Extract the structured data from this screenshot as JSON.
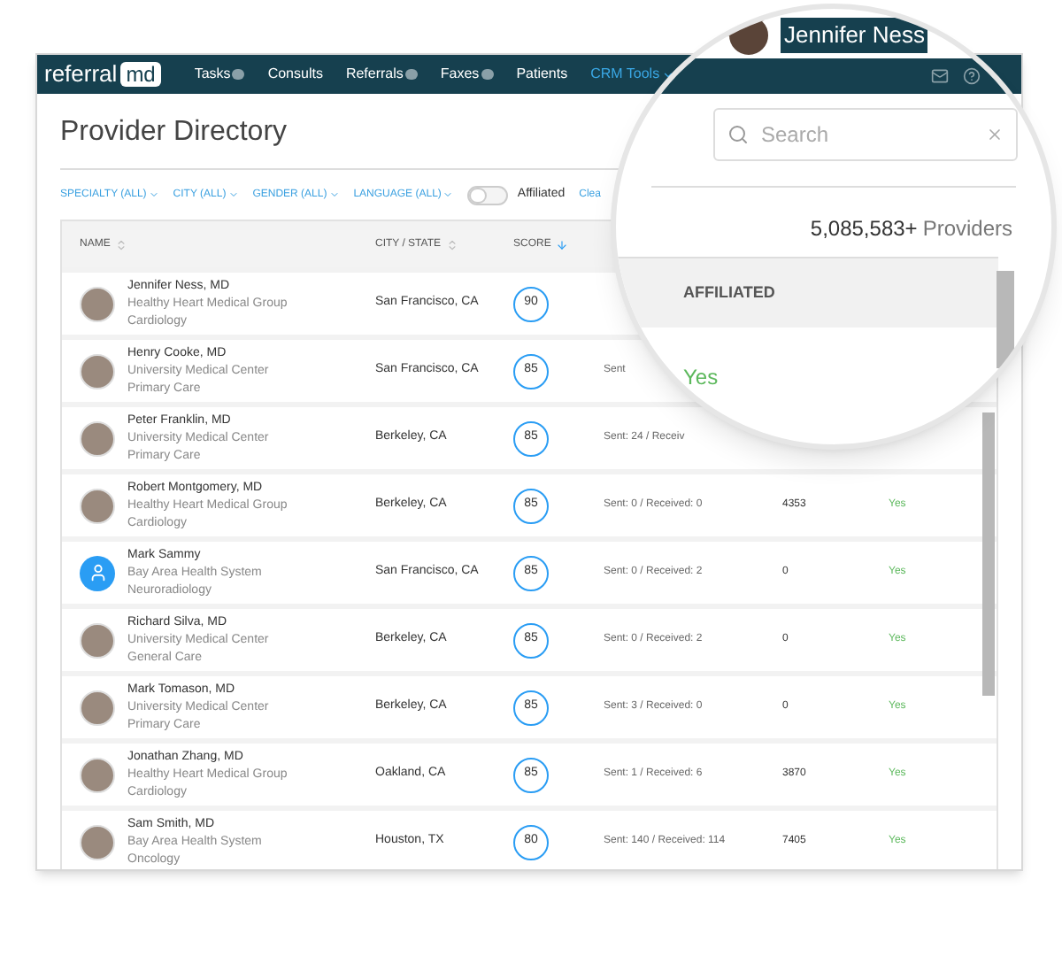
{
  "logo": {
    "text": "referral",
    "badge": "md"
  },
  "nav": [
    {
      "label": "Tasks",
      "has_badge": true,
      "selected": false,
      "dropdown": false
    },
    {
      "label": "Consults",
      "has_badge": false,
      "selected": false,
      "dropdown": false
    },
    {
      "label": "Referrals",
      "has_badge": true,
      "selected": false,
      "dropdown": false
    },
    {
      "label": "Faxes",
      "has_badge": true,
      "selected": false,
      "dropdown": false
    },
    {
      "label": "Patients",
      "has_badge": false,
      "selected": false,
      "dropdown": false
    },
    {
      "label": "CRM Tools",
      "has_badge": false,
      "selected": true,
      "dropdown": true
    }
  ],
  "page_title": "Provider Directory",
  "filters": [
    "SPECIALTY (ALL)",
    "CITY (ALL)",
    "GENDER (ALL)",
    "LANGUAGE (ALL)"
  ],
  "affiliated_toggle": {
    "label": "Affiliated",
    "on": false
  },
  "clear_link": "Clea",
  "table": {
    "columns": [
      {
        "label": "NAME",
        "sorted": false
      },
      {
        "label": "CITY / STATE",
        "sorted": false
      },
      {
        "label": "SCORE",
        "sorted": true
      }
    ],
    "rows": [
      {
        "name": "Jennifer Ness, MD",
        "org": "Healthy Heart Medical Group",
        "specialty": "Cardiology",
        "generic_avatar": false,
        "city": "San Francisco, CA",
        "score": "90"
      },
      {
        "name": "Henry Cooke, MD",
        "org": "University Medical Center",
        "specialty": "Primary Care",
        "generic_avatar": false,
        "city": "San Francisco, CA",
        "score": "85",
        "referrals": "Sent"
      },
      {
        "name": "Peter Franklin, MD",
        "org": "University Medical Center",
        "specialty": "Primary Care",
        "generic_avatar": false,
        "city": "Berkeley, CA",
        "score": "85",
        "referrals": "Sent: 24 / Receiv"
      },
      {
        "name": "Robert Montgomery, MD",
        "org": "Healthy Heart Medical Group",
        "specialty": "Cardiology",
        "generic_avatar": false,
        "city": "Berkeley, CA",
        "score": "85",
        "referrals": "Sent: 0 / Received: 0",
        "column_5": "4353",
        "affiliated": "Yes"
      },
      {
        "name": "Mark Sammy",
        "org": "Bay Area Health System",
        "specialty": "Neuroradiology",
        "generic_avatar": true,
        "city": "San Francisco, CA",
        "score": "85",
        "referrals": "Sent: 0 / Received: 2",
        "column_5": "0",
        "affiliated": "Yes"
      },
      {
        "name": "Richard Silva, MD",
        "org": "University Medical Center",
        "specialty": "General Care",
        "generic_avatar": false,
        "city": "Berkeley, CA",
        "score": "85",
        "referrals": "Sent: 0 / Received: 2",
        "column_5": "0",
        "affiliated": "Yes"
      },
      {
        "name": "Mark Tomason, MD",
        "org": "University Medical Center",
        "specialty": "Primary Care",
        "generic_avatar": false,
        "city": "Berkeley, CA",
        "score": "85",
        "referrals": "Sent: 3 / Received: 0",
        "column_5": "0",
        "affiliated": "Yes"
      },
      {
        "name": "Jonathan Zhang, MD",
        "org": "Healthy Heart Medical Group",
        "specialty": "Cardiology",
        "generic_avatar": false,
        "city": "Oakland, CA",
        "score": "85",
        "referrals": "Sent: 1 / Received: 6",
        "column_5": "3870",
        "affiliated": "Yes"
      },
      {
        "name": "Sam Smith, MD",
        "org": "Bay Area Health System",
        "specialty": "Oncology",
        "generic_avatar": false,
        "city": "Houston, TX",
        "score": "80",
        "referrals": "Sent: 140 / Received: 114",
        "column_5": "7405",
        "affiliated": "Yes"
      }
    ]
  },
  "magnifier": {
    "user_name": "Jennifer Ness",
    "search": {
      "placeholder": "Search"
    },
    "count": "5,085,583+",
    "count_label": "Providers",
    "column_header": "AFFILIATED",
    "value": "Yes"
  }
}
